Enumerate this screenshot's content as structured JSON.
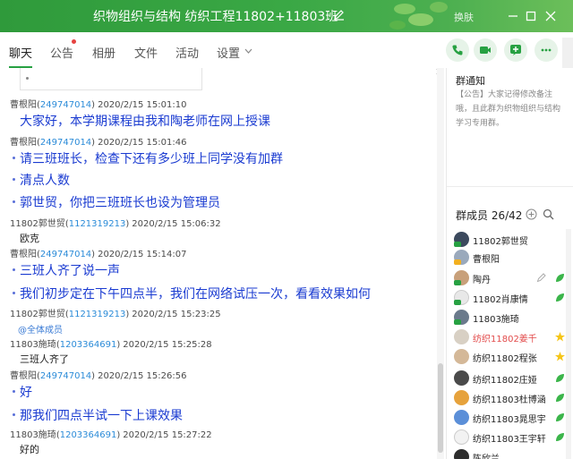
{
  "window": {
    "title": "织物组织与结构 纺织工程11802+11803班",
    "skin_label": "换肤"
  },
  "tabs": [
    {
      "label": "聊天"
    },
    {
      "label": "公告"
    },
    {
      "label": "相册"
    },
    {
      "label": "文件"
    },
    {
      "label": "活动"
    },
    {
      "label": "设置"
    }
  ],
  "colors": {
    "title_green": "#2f9a3b",
    "message_blue": "#1a3bd1",
    "qq_link": "#2b8bd8",
    "accent": "#27a142"
  },
  "messages": [
    {
      "sender": "曹根阳",
      "qq": "249747014",
      "time": "2020/2/15 15:01:10",
      "lines": [
        "大家好，本学期课程由我和陶老师在网上授课"
      ]
    },
    {
      "sender": "曹根阳",
      "qq": "249747014",
      "time": "2020/2/15 15:01:46",
      "lines": [
        "请三班班长，检查下还有多少班上同学没有加群",
        "清点人数",
        "郭世贸，你把三班班长也设为管理员"
      ]
    },
    {
      "sender": "11802郭世贸",
      "qq": "1121319213",
      "time": "2020/2/15 15:06:32",
      "lines": [
        "欧克"
      ]
    },
    {
      "sender": "曹根阳",
      "qq": "249747014",
      "time": "2020/2/15 15:14:07",
      "lines": [
        "三班人齐了说一声",
        "我们初步定在下午四点半，我们在网络试压一次，看看效果如何"
      ]
    },
    {
      "sender": "11802郭世贸",
      "qq": "1121319213",
      "time": "2020/2/15 15:23:25",
      "lines": [
        "@全体成员"
      ]
    },
    {
      "sender": "11803施琦",
      "qq": "1203364691",
      "time": "2020/2/15 15:25:28",
      "lines": [
        "三班人齐了"
      ]
    },
    {
      "sender": "曹根阳",
      "qq": "249747014",
      "time": "2020/2/15 15:26:56",
      "lines": [
        "好",
        "那我们四点半试一下上课效果"
      ]
    },
    {
      "sender": "11803施琦",
      "qq": "1203364691",
      "time": "2020/2/15 15:27:22",
      "lines": [
        "好的"
      ]
    }
  ],
  "notice": {
    "title": "群通知",
    "text": "【公告】大家记得修改备注哦，且此群为织物组织与结构学习专用群。"
  },
  "members": {
    "title": "群成员 26/42",
    "list": [
      {
        "name": "11802郭世贸"
      },
      {
        "name": "曹根阳"
      },
      {
        "name": "陶丹"
      },
      {
        "name": "11802肖康情"
      },
      {
        "name": "11803施琦"
      },
      {
        "name": "纺织11802姜千"
      },
      {
        "name": "纺织11802程张"
      },
      {
        "name": "纺织11802庄娅"
      },
      {
        "name": "纺织11803杜博涵"
      },
      {
        "name": "纺织11803晁思宇"
      },
      {
        "name": "纺织11803王宇轩"
      },
      {
        "name": "陈欣兰"
      }
    ]
  }
}
